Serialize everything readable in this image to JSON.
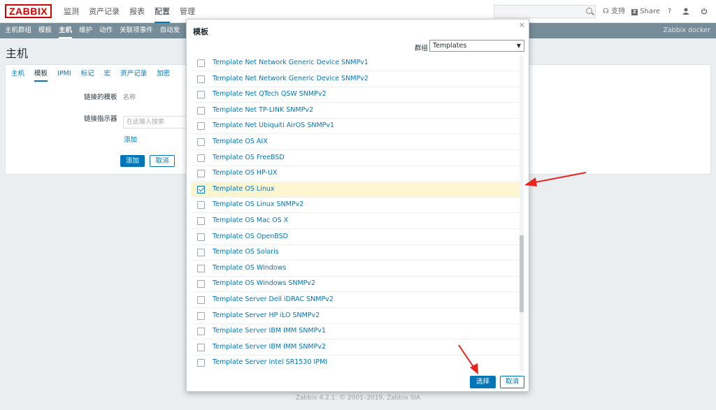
{
  "app": {
    "logo": "ZABBIX"
  },
  "main_menu": [
    {
      "label": "监测",
      "active": false
    },
    {
      "label": "资产记录",
      "active": false
    },
    {
      "label": "报表",
      "active": false
    },
    {
      "label": "配置",
      "active": true
    },
    {
      "label": "管理",
      "active": false
    }
  ],
  "top_links": {
    "support": "支持",
    "share": "Share",
    "help": "?"
  },
  "sub_menu": [
    {
      "label": "主机群组",
      "active": false
    },
    {
      "label": "模板",
      "active": false
    },
    {
      "label": "主机",
      "active": true
    },
    {
      "label": "维护",
      "active": false
    },
    {
      "label": "动作",
      "active": false
    },
    {
      "label": "关联项事件",
      "active": false
    },
    {
      "label": "自动发",
      "active": false
    }
  ],
  "sub_right": "Zabbix docker",
  "page": {
    "title": "主机"
  },
  "host_tabs": [
    {
      "label": "主机",
      "active": false
    },
    {
      "label": "模板",
      "active": true
    },
    {
      "label": "IPMI",
      "active": false
    },
    {
      "label": "标记",
      "active": false
    },
    {
      "label": "宏",
      "active": false
    },
    {
      "label": "资产记录",
      "active": false
    },
    {
      "label": "加密",
      "active": false
    }
  ],
  "form": {
    "linked_label": "链接的模板",
    "linked_name_col": "名称",
    "link_indicator_label": "链接指示器",
    "search_placeholder": "在此输入搜索",
    "add_link": "添加",
    "add_button": "添加",
    "cancel_button": "取消"
  },
  "footer": "Zabbix 4.2.1. © 2001–2019, Zabbix SIA",
  "modal": {
    "title": "模板",
    "group_label": "群组",
    "group_value": "Templates",
    "select_button": "选择",
    "cancel_button": "取消",
    "scroll_position": 0.75,
    "items": [
      {
        "name": "Template Net Network Generic Device SNMPv1",
        "checked": false
      },
      {
        "name": "Template Net Network Generic Device SNMPv2",
        "checked": false
      },
      {
        "name": "Template Net QTech QSW SNMPv2",
        "checked": false
      },
      {
        "name": "Template Net TP-LINK SNMPv2",
        "checked": false
      },
      {
        "name": "Template Net Ubiquiti AirOS SNMPv1",
        "checked": false
      },
      {
        "name": "Template OS AIX",
        "checked": false
      },
      {
        "name": "Template OS FreeBSD",
        "checked": false
      },
      {
        "name": "Template OS HP-UX",
        "checked": false
      },
      {
        "name": "Template OS Linux",
        "checked": true
      },
      {
        "name": "Template OS Linux SNMPv2",
        "checked": false
      },
      {
        "name": "Template OS Mac OS X",
        "checked": false
      },
      {
        "name": "Template OS OpenBSD",
        "checked": false
      },
      {
        "name": "Template OS Solaris",
        "checked": false
      },
      {
        "name": "Template OS Windows",
        "checked": false
      },
      {
        "name": "Template OS Windows SNMPv2",
        "checked": false
      },
      {
        "name": "Template Server Dell iDRAC SNMPv2",
        "checked": false
      },
      {
        "name": "Template Server HP iLO SNMPv2",
        "checked": false
      },
      {
        "name": "Template Server IBM IMM SNMPv1",
        "checked": false
      },
      {
        "name": "Template Server IBM IMM SNMPv2",
        "checked": false
      },
      {
        "name": "Template Server Intel SR1530 IPMI",
        "checked": false
      }
    ]
  },
  "colors": {
    "brand": "#d40000",
    "accent": "#0275b8",
    "highlight": "#fbf6cf",
    "annotation": "#e8241c"
  }
}
